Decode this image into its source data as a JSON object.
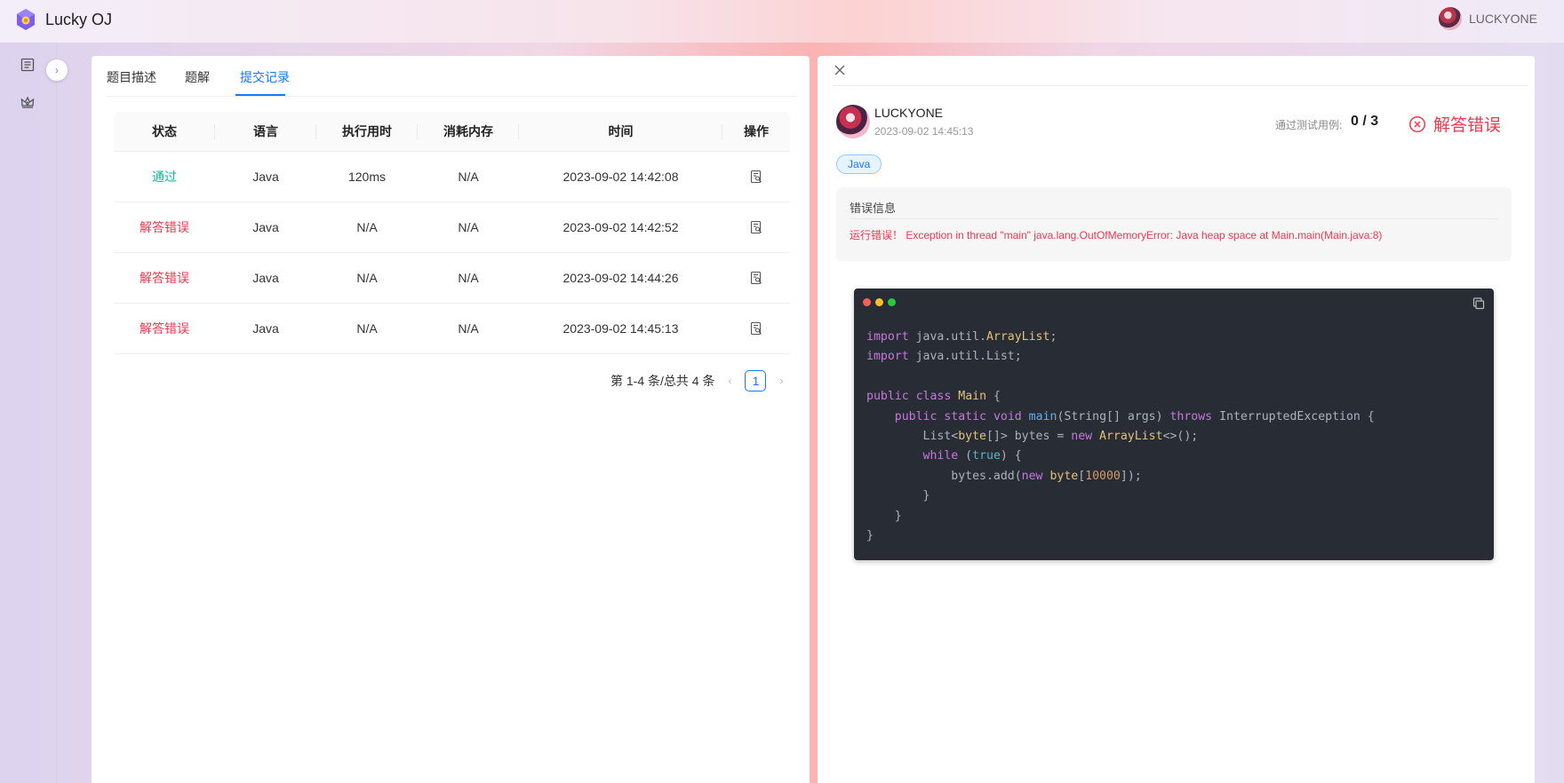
{
  "app": {
    "title": "Lucky OJ",
    "logo_icon": "hexagon-logo-icon"
  },
  "user": {
    "name": "LUCKYONE"
  },
  "tabs": [
    {
      "label": "题目描述",
      "active": false
    },
    {
      "label": "题解",
      "active": false
    },
    {
      "label": "提交记录",
      "active": true
    }
  ],
  "table": {
    "headers": [
      "状态",
      "语言",
      "执行用时",
      "消耗内存",
      "时间",
      "操作"
    ],
    "rows": [
      {
        "status": "通过",
        "status_type": "ok",
        "lang": "Java",
        "time": "120ms",
        "mem": "N/A",
        "date": "2023-09-02 14:42:08"
      },
      {
        "status": "解答错误",
        "status_type": "err",
        "lang": "Java",
        "time": "N/A",
        "mem": "N/A",
        "date": "2023-09-02 14:42:52"
      },
      {
        "status": "解答错误",
        "status_type": "err",
        "lang": "Java",
        "time": "N/A",
        "mem": "N/A",
        "date": "2023-09-02 14:44:26"
      },
      {
        "status": "解答错误",
        "status_type": "err",
        "lang": "Java",
        "time": "N/A",
        "mem": "N/A",
        "date": "2023-09-02 14:45:13"
      }
    ]
  },
  "pagination": {
    "total_text": "第 1-4 条/总共 4 条",
    "current": "1"
  },
  "detail": {
    "username": "LUCKYONE",
    "time": "2023-09-02 14:45:13",
    "pass_label": "通过测试用例:",
    "pass_value": "0 / 3",
    "status": "解答错误",
    "language": "Java",
    "error_title": "错误信息",
    "error_message": "运行错误！ Exception in thread \"main\" java.lang.OutOfMemoryError: Java heap space at Main.main(Main.java:8)"
  },
  "code": {
    "lines": [
      "import java.util.ArrayList;",
      "import java.util.List;",
      "",
      "public class Main {",
      "    public static void main(String[] args) throws InterruptedException {",
      "        List<byte[]> bytes = new ArrayList<>();",
      "        while (true) {",
      "            bytes.add(new byte[10000]);",
      "        }",
      "    }",
      "}"
    ]
  },
  "colors": {
    "accent": "#1677ff",
    "success": "#13b39a",
    "error": "#f0384f",
    "code_bg": "#282c34"
  }
}
